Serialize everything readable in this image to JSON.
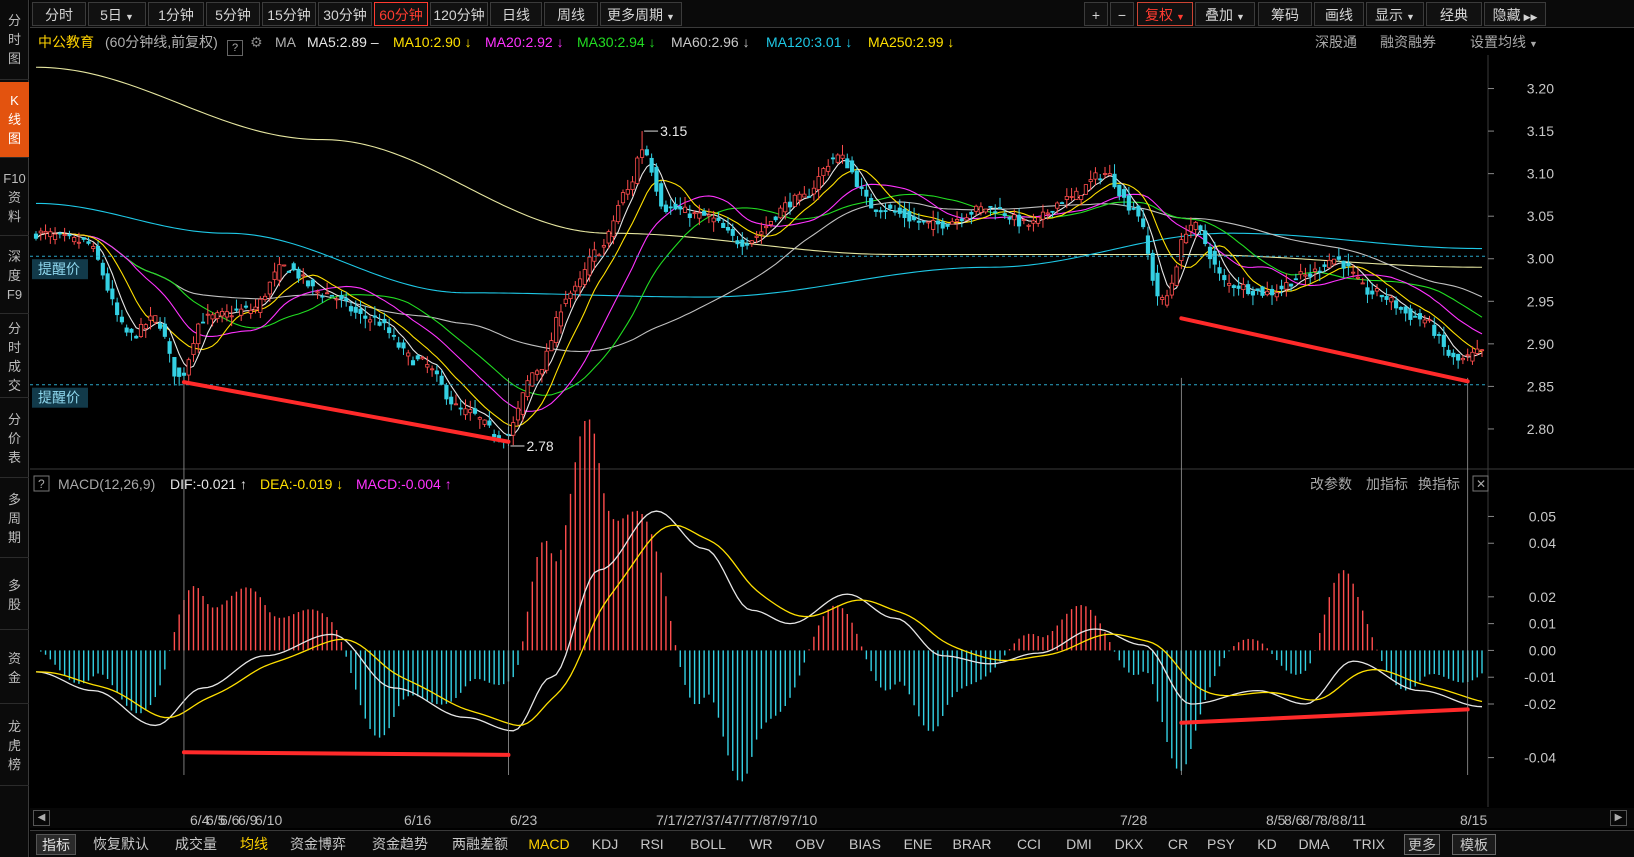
{
  "colors": {
    "up": "#ff4d4d",
    "down": "#34d0e3",
    "ma5": "#e6e6e6",
    "ma10": "#ffe000",
    "ma20": "#ff33ff",
    "ma30": "#22dd22",
    "ma60": "#c0c0c0",
    "ma120": "#1ec8e6",
    "ma250": "#e6e6a0",
    "accent": "#e3530f",
    "divergence_line": "#ff2a2a",
    "alert_line": "#2aa6c8"
  },
  "leftnav": [
    {
      "label": "分\n时\n图",
      "icon": "none"
    },
    {
      "label": "K\n线\n图",
      "active": true
    },
    {
      "label": "F10\n资\n料"
    },
    {
      "label": "深\n度\nF9"
    },
    {
      "label": "分\n时\n成\n交"
    },
    {
      "label": "分\n价\n表"
    },
    {
      "label": "多\n周\n期"
    },
    {
      "label": "多\n股"
    },
    {
      "label": "资\n金"
    },
    {
      "label": "龙\n虎\n榜"
    }
  ],
  "toolbar": {
    "periods": [
      "分时",
      "5日",
      "1分钟",
      "5分钟",
      "15分钟",
      "30分钟",
      "60分钟",
      "120分钟",
      "日线",
      "周线",
      "更多周期"
    ],
    "active_period": "60分钟",
    "zoom_in": "+",
    "zoom_out": "−",
    "right_buttons": [
      "复权",
      "叠加",
      "筹码",
      "画线",
      "显示",
      "经典",
      "隐藏"
    ]
  },
  "info": {
    "stock_name": "中公教育",
    "period_desc": "(60分钟线,前复权)",
    "help": "?",
    "ma_label": "MA",
    "ma5": "MA5:2.89 –",
    "ma10": "MA10:2.90 ↓",
    "ma20": "MA20:2.92 ↓",
    "ma30": "MA30:2.94 ↓",
    "ma60": "MA60:2.96 ↓",
    "ma120": "MA120:3.01 ↓",
    "ma250": "MA250:2.99 ↓",
    "right_links": [
      "深股通",
      "融资融券",
      "设置均线"
    ]
  },
  "price_axis": {
    "ticks": [
      "3.20",
      "3.15",
      "3.10",
      "3.05",
      "3.00",
      "2.95",
      "2.90",
      "2.85",
      "2.80"
    ],
    "ymin": 2.76,
    "ymax": 3.23
  },
  "alerts": [
    {
      "label": "提醒价",
      "price": 3.003
    },
    {
      "label": "提醒价",
      "price": 2.852
    }
  ],
  "annotations": {
    "high": "3.15",
    "low": "2.78"
  },
  "macd": {
    "title": "MACD(12,26,9)",
    "dif": "DIF:-0.021 ↑",
    "dea": "DEA:-0.019 ↓",
    "macd": "MACD:-0.004 ↑",
    "links": [
      "改参数",
      "加指标",
      "换指标"
    ],
    "close": "✕",
    "ticks": [
      "0.05",
      "0.04",
      "0.02",
      "0.01",
      "0.00",
      "-0.01",
      "-0.02",
      "-0.04"
    ]
  },
  "x_labels": [
    "6/4",
    "6/5",
    "6/6",
    "6/9",
    "6/10",
    "6/16",
    "6/23",
    "7/1",
    "7/2",
    "7/3",
    "7/4",
    "7/7",
    "7/8",
    "7/9",
    "7/10",
    "7/28",
    "8/5",
    "8/6",
    "8/7",
    "8/8",
    "8/11",
    "8/15"
  ],
  "bottom_tabs": [
    "指标",
    "恢复默认",
    "成交量",
    "均线",
    "资金博弈",
    "资金趋势",
    "两融差额",
    "MACD",
    "KDJ",
    "RSI",
    "BOLL",
    "WR",
    "OBV",
    "BIAS",
    "ENE",
    "BRAR",
    "CCI",
    "DMI",
    "DKX",
    "CR",
    "PSY",
    "KD",
    "DMA",
    "TRIX",
    "更多",
    "模板"
  ],
  "chart_data": {
    "type": "candlestick",
    "title": "中公教育 (60分钟线,前复权)",
    "x_ticks": [
      "6/4",
      "6/5",
      "6/6",
      "6/9",
      "6/10",
      "6/16",
      "6/23",
      "7/1",
      "7/2",
      "7/3",
      "7/4",
      "7/7",
      "7/8",
      "7/9",
      "7/10",
      "7/28",
      "8/5",
      "8/6",
      "8/7",
      "8/8",
      "8/11",
      "8/15"
    ],
    "price_keypoints": [
      {
        "i": 0,
        "p": 3.03
      },
      {
        "i": 10,
        "p": 3.02
      },
      {
        "i": 20,
        "p": 2.91
      },
      {
        "i": 25,
        "p": 2.93
      },
      {
        "i": 30,
        "p": 2.86
      },
      {
        "i": 35,
        "p": 2.93
      },
      {
        "i": 45,
        "p": 2.94
      },
      {
        "i": 52,
        "p": 2.99
      },
      {
        "i": 60,
        "p": 2.96
      },
      {
        "i": 70,
        "p": 2.93
      },
      {
        "i": 80,
        "p": 2.88
      },
      {
        "i": 90,
        "p": 2.82
      },
      {
        "i": 98,
        "p": 2.79
      },
      {
        "i": 105,
        "p": 2.87
      },
      {
        "i": 112,
        "p": 2.96
      },
      {
        "i": 118,
        "p": 3.01
      },
      {
        "i": 124,
        "p": 3.08
      },
      {
        "i": 127,
        "p": 3.13
      },
      {
        "i": 132,
        "p": 3.06
      },
      {
        "i": 140,
        "p": 3.05
      },
      {
        "i": 148,
        "p": 3.02
      },
      {
        "i": 160,
        "p": 3.07
      },
      {
        "i": 168,
        "p": 3.12
      },
      {
        "i": 176,
        "p": 3.06
      },
      {
        "i": 188,
        "p": 3.04
      },
      {
        "i": 200,
        "p": 3.06
      },
      {
        "i": 208,
        "p": 3.04
      },
      {
        "i": 216,
        "p": 3.07
      },
      {
        "i": 224,
        "p": 3.1
      },
      {
        "i": 230,
        "p": 3.06
      },
      {
        "i": 236,
        "p": 2.95
      },
      {
        "i": 242,
        "p": 3.04
      },
      {
        "i": 250,
        "p": 2.97
      },
      {
        "i": 258,
        "p": 2.96
      },
      {
        "i": 266,
        "p": 2.98
      },
      {
        "i": 272,
        "p": 3.0
      },
      {
        "i": 280,
        "p": 2.96
      },
      {
        "i": 290,
        "p": 2.93
      },
      {
        "i": 298,
        "p": 2.88
      },
      {
        "i": 303,
        "p": 2.89
      }
    ],
    "macd_keypoints": [
      {
        "i": 0,
        "v": -0.008
      },
      {
        "i": 12,
        "v": -0.015
      },
      {
        "i": 25,
        "v": -0.028
      },
      {
        "i": 35,
        "v": -0.014
      },
      {
        "i": 48,
        "v": -0.002
      },
      {
        "i": 62,
        "v": 0.006
      },
      {
        "i": 75,
        "v": -0.014
      },
      {
        "i": 90,
        "v": -0.025
      },
      {
        "i": 100,
        "v": -0.03
      },
      {
        "i": 108,
        "v": -0.01
      },
      {
        "i": 118,
        "v": 0.03
      },
      {
        "i": 130,
        "v": 0.052
      },
      {
        "i": 140,
        "v": 0.038
      },
      {
        "i": 150,
        "v": 0.015
      },
      {
        "i": 158,
        "v": 0.01
      },
      {
        "i": 170,
        "v": 0.021
      },
      {
        "i": 180,
        "v": 0.012
      },
      {
        "i": 190,
        "v": -0.002
      },
      {
        "i": 200,
        "v": -0.005
      },
      {
        "i": 210,
        "v": -0.001
      },
      {
        "i": 222,
        "v": 0.008
      },
      {
        "i": 232,
        "v": 0.002
      },
      {
        "i": 242,
        "v": -0.02
      },
      {
        "i": 256,
        "v": -0.015
      },
      {
        "i": 266,
        "v": -0.02
      },
      {
        "i": 276,
        "v": -0.004
      },
      {
        "i": 290,
        "v": -0.015
      },
      {
        "i": 303,
        "v": -0.021
      }
    ],
    "divergences_price": [
      {
        "from": {
          "i": 31,
          "p": 2.855
        },
        "to": {
          "i": 99,
          "p": 2.785
        }
      },
      {
        "from": {
          "i": 240,
          "p": 2.93
        },
        "to": {
          "i": 300,
          "p": 2.856
        }
      }
    ],
    "divergences_macd": [
      {
        "from": {
          "i": 31,
          "v": -0.038
        },
        "to": {
          "i": 99,
          "v": -0.039
        }
      },
      {
        "from": {
          "i": 240,
          "v": -0.027
        },
        "to": {
          "i": 300,
          "v": -0.022
        }
      }
    ],
    "ma_levels_end": {
      "MA5": 2.89,
      "MA10": 2.9,
      "MA20": 2.92,
      "MA30": 2.94,
      "MA60": 2.96,
      "MA120": 3.01,
      "MA250": 2.99
    }
  }
}
